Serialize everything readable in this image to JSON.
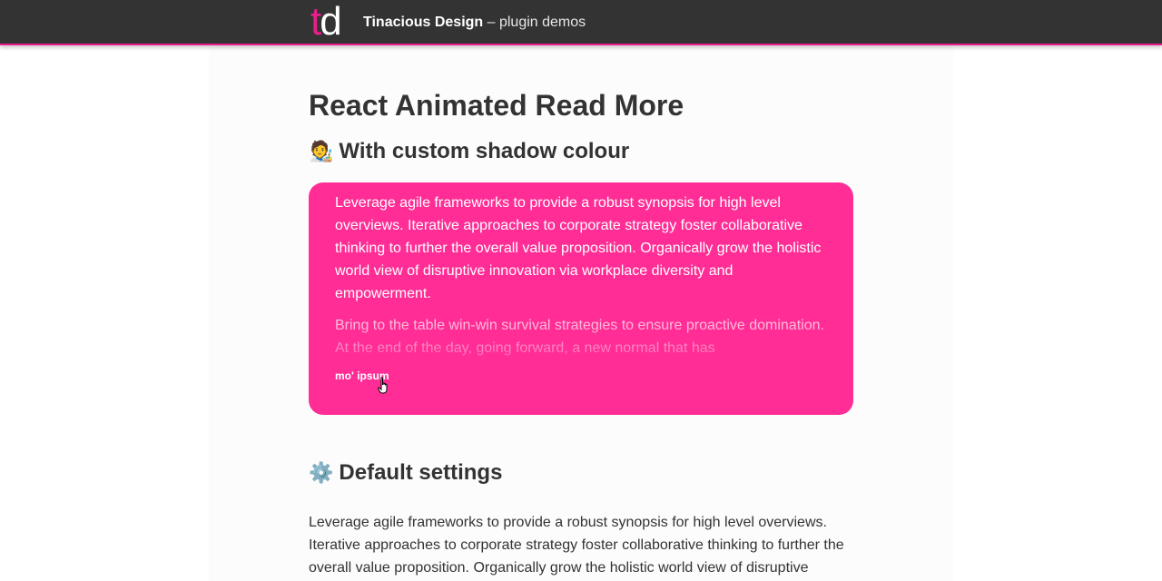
{
  "header": {
    "logo_t": "t",
    "logo_d": "d",
    "brand_name": "Tinacious Design",
    "brand_sub": " – plugin demos"
  },
  "page": {
    "title": "React Animated Read More"
  },
  "custom_section": {
    "emoji": "🧑‍🎨",
    "heading": "With custom shadow colour",
    "paragraph1": "Leverage agile frameworks to provide a robust synopsis for high level overviews. Iterative approaches to corporate strategy foster collaborative thinking to further the overall value proposition. Organically grow the holistic world view of disruptive innovation via workplace diversity and empowerment.",
    "paragraph2": "Bring to the table win-win survival strategies to ensure proactive domination. At the end of the day, going forward, a new normal that has",
    "more_label": "mo' ipsum",
    "card_color": "#ff2d95"
  },
  "default_section": {
    "emoji": "⚙️",
    "heading": "Default settings",
    "paragraph1": "Leverage agile frameworks to provide a robust synopsis for high level overviews. Iterative approaches to corporate strategy foster collaborative thinking to further the overall value proposition. Organically grow the holistic world view of disruptive"
  },
  "colors": {
    "header_bg": "#333333",
    "accent": "#e91e8c"
  }
}
